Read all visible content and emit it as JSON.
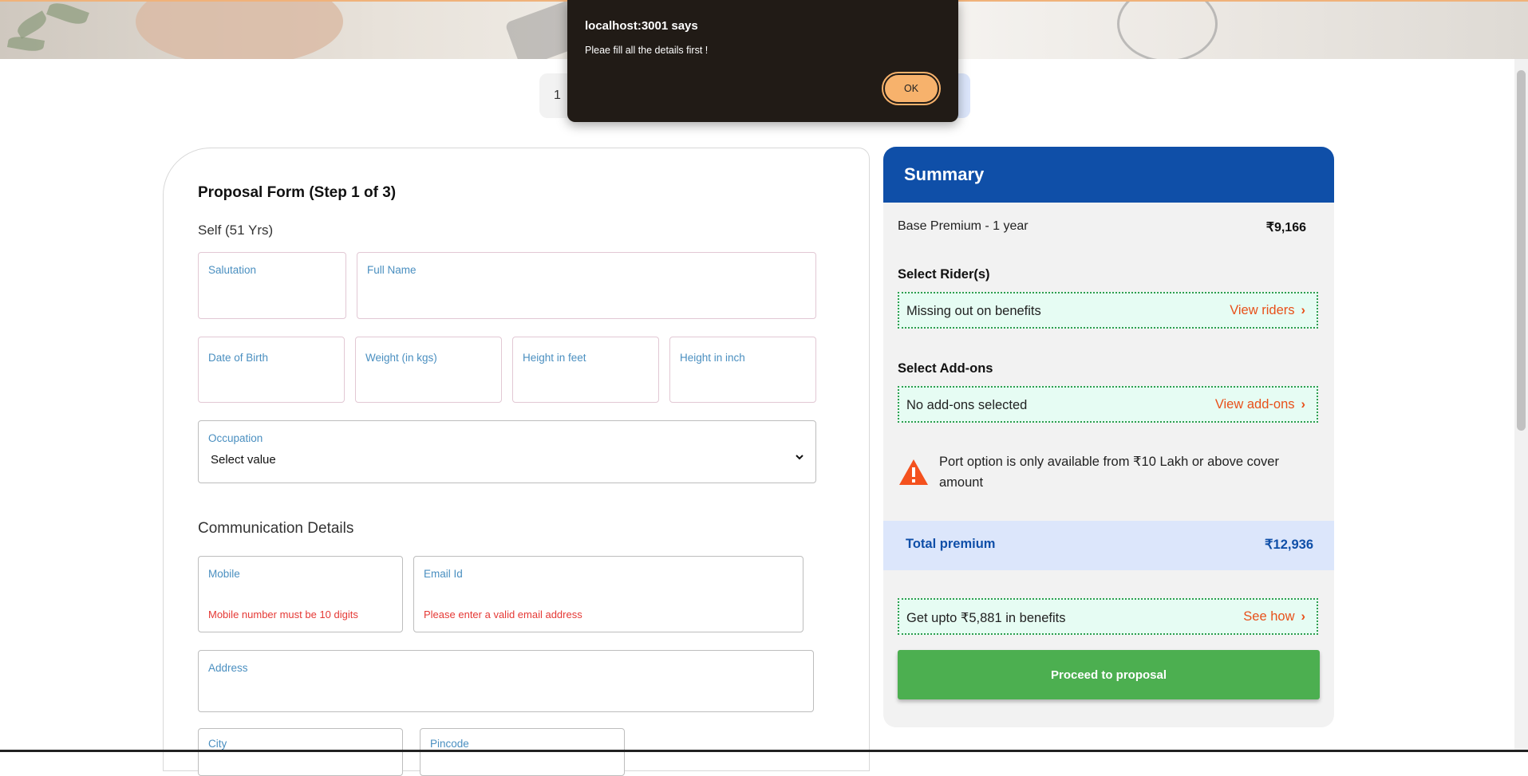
{
  "dialog": {
    "origin": "localhost:3001 says",
    "message": "Pleae fill all the details first !",
    "ok_label": "OK"
  },
  "stepper": {
    "visible_text": "1"
  },
  "form": {
    "title": "Proposal Form (Step 1 of 3)",
    "member": "Self (51 Yrs)",
    "fields": {
      "salutation": "Salutation",
      "full_name": "Full Name",
      "dob": "Date of Birth",
      "weight": "Weight (in kgs)",
      "height_feet": "Height in feet",
      "height_inch": "Height in inch",
      "occupation": "Occupation",
      "occupation_value": "Select value"
    },
    "communication": {
      "title": "Communication Details",
      "mobile": "Mobile",
      "mobile_error": "Mobile number must be 10 digits",
      "email": "Email Id",
      "email_error": "Please enter a valid email address",
      "address": "Address",
      "city": "City",
      "pincode": "Pincode"
    }
  },
  "summary": {
    "title": "Summary",
    "base_label": "Base Premium - 1 year",
    "base_value": "₹9,166",
    "riders_title": "Select Rider(s)",
    "riders_text": "Missing out on benefits",
    "riders_link": "View riders",
    "addons_title": "Select Add-ons",
    "addons_text": "No add-ons selected",
    "addons_link": "View add-ons",
    "warning": "Port option is only available from ₹10 Lakh or above cover amount",
    "total_label": "Total premium",
    "total_value": "₹12,936",
    "benefits_text": "Get upto ₹5,881 in benefits",
    "benefits_link": "See how",
    "proceed_label": "Proceed to proposal"
  },
  "colors": {
    "primary_blue": "#0f4fa8",
    "green_button": "#4caf50",
    "link_orange": "#e8501a",
    "error_red": "#e53935",
    "dialog_bg": "#211b16",
    "ok_button": "#f7b26c"
  },
  "icons": [
    "warning-triangle-icon",
    "chevron-right-icon",
    "chevron-down-icon"
  ]
}
